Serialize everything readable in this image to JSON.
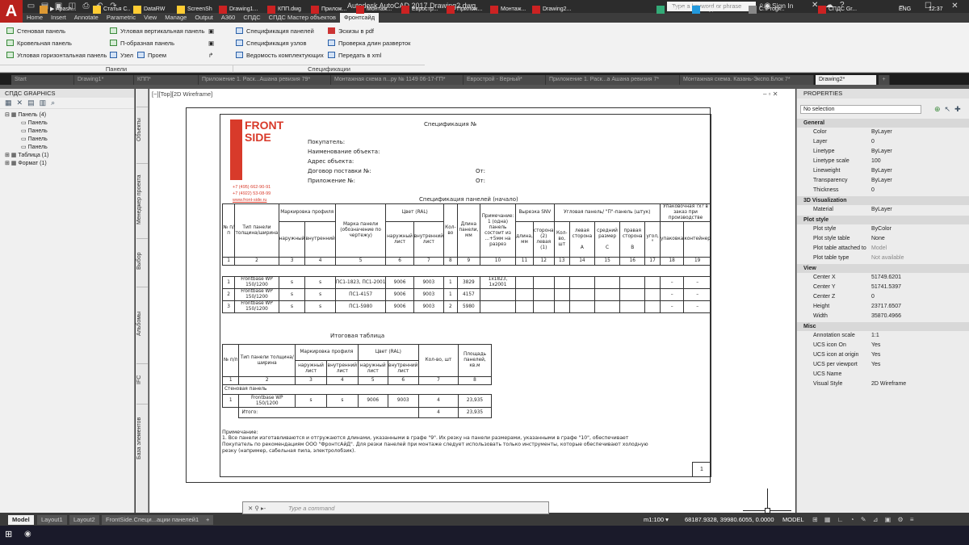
{
  "titlebar": {
    "app_letter": "A",
    "title": "Autodesk AutoCAD 2017   Drawing2.dwg",
    "search_placeholder": "Type a keyword or phrase",
    "sign_in": "Sign In"
  },
  "ribbon_tabs": [
    "Home",
    "Insert",
    "Annotate",
    "Parametric",
    "View",
    "Manage",
    "Output",
    "A360",
    "СПДС",
    "СПДС Мастер объектов",
    "Фронтсайд"
  ],
  "ribbon": {
    "col1": [
      "Стеновая панель",
      "Кровельная панель",
      "Угловая горизонтальная панель"
    ],
    "col2": [
      "Угловая вертикальная панель",
      "П-образная панель",
      "Узел",
      "Проем"
    ],
    "col3": [
      "Спецификация панелей",
      "Спецификация узлов",
      "Ведомость комплектующих"
    ],
    "col4": [
      "Эскизы в pdf",
      "Проверка длин разверток",
      "Передать в xml"
    ],
    "panel1": "Панели",
    "panel2": "Спецификации"
  },
  "file_tabs": [
    "Start",
    "Drawing1*",
    "КПП*",
    "Приложение 1. Раск...Ашана ревизия 79*",
    "Монтажная схема п...ру № 1149 06-17-ГП*",
    "Еврострой - Верный*",
    "Приложение 1. Раск...а Ашана ревизия 7*",
    "Монтажная схема. Казань-Экспо.Блок 7*",
    "Drawing2*"
  ],
  "left_palette": {
    "title": "СПДС GRAPHICS",
    "tree": [
      "Панель (4)",
      "Панель",
      "Панель",
      "Панель",
      "Панель",
      "Таблица (1)",
      "Формат (1)"
    ],
    "side_tabs": [
      "Объекты",
      "Менеджер проекта",
      "Выбор",
      "Альбомы",
      "IFC",
      "База элементов"
    ]
  },
  "viewport": {
    "label": "[−][Top][2D Wireframe]"
  },
  "sheet": {
    "logo": [
      "FRONT",
      "SIDE"
    ],
    "contacts": [
      "+7 (495) 662-90-91",
      "+7 (4922) 53-08-99",
      "www.front-side.ru"
    ],
    "title": "Спецификация №",
    "header_fields": [
      "Покупатель:",
      "Наименование объекта:",
      "Адрес объекта:",
      "Договор поставки №:",
      "Приложение №:"
    ],
    "from1": "От:",
    "from2": "От:",
    "table1_title": "Спецификация панелей (начало)",
    "t1_headers": [
      "№ п/п",
      "Тип панели толщина/ширина",
      "Маркировка профиля",
      "Марка панели (обозначение по чертежу)",
      "Цвет (RAL)",
      "Кол-во",
      "Длина панели, мм",
      "Примечание: 1 (одна) панель состоит из ...+5мм на разрез",
      "Вырезка SNV",
      "Угловая панель/ \"П\"-панель (штук)",
      "Упаковочная ?х? в заказ при производстве"
    ],
    "t1_sub": [
      "наружный",
      "внутренний",
      "наружный лист",
      "внутренний лист",
      "длина, мм",
      "сторона (2) левая (1)",
      "Кол-во, шт",
      "левая сторона",
      "средний размер",
      "правая сторона",
      "угол, °",
      "упаковка",
      "контейнер"
    ],
    "t1_letters": [
      "А",
      "С",
      "В"
    ],
    "t1_nums": [
      "1",
      "2",
      "3",
      "4",
      "5",
      "6",
      "7",
      "8",
      "9",
      "10",
      "11",
      "12",
      "13",
      "14",
      "15",
      "16",
      "17",
      "18",
      "19"
    ],
    "t1_rows": [
      [
        "1",
        "Frontbase WP 150/1200",
        "s",
        "s",
        "ПС1-1823, ПС1-2001",
        "9006",
        "9003",
        "1",
        "3829",
        "1x1823, 1x2001",
        "–",
        "–"
      ],
      [
        "2",
        "Frontbase WP 150/1200",
        "s",
        "s",
        "ПС1-4157",
        "9006",
        "9003",
        "1",
        "4157",
        "",
        "–",
        "–"
      ],
      [
        "3",
        "Frontbase WP 150/1200",
        "s",
        "s",
        "ПС1-5980",
        "9006",
        "9003",
        "2",
        "5980",
        "",
        "–",
        "–"
      ]
    ],
    "table2_title": "Итоговая таблица",
    "t2_headers": [
      "№ п/п",
      "Тип панели толщина/ширина",
      "Маркировка профиля",
      "Цвет (RAL)",
      "Кол-во, шт",
      "Площадь панелей, кв.м"
    ],
    "t2_sub": [
      "наружный лист",
      "внутренний лист",
      "наружный лист",
      "внутренний лист"
    ],
    "t2_nums": [
      "1",
      "2",
      "3",
      "4",
      "5",
      "6",
      "7",
      "8"
    ],
    "t2_section": "Стеновая панель",
    "t2_row": [
      "1",
      "Frontbase WP 150/1200",
      "s",
      "s",
      "9006",
      "9003",
      "4",
      "23,935"
    ],
    "t2_total_label": "Итого:",
    "t2_total_qty": "4",
    "t2_total_area": "23,935",
    "notes_title": "Примечание:",
    "notes": [
      "1. Все панели изготавливаются и отгружаются длинами, указанными в графе \"9\". Их резку на панели размерами, указанными в графе \"10\", обеспечивает",
      "Покупатель по рекомендациям ООО \"ФронтсАйД\". Для резки панелей при монтаже следует использовать только инструменты, которые обеспечивают холодную",
      "резку (например, сабельная пила, электролобзик)."
    ],
    "page": "1"
  },
  "properties": {
    "title": "PROPERTIES",
    "selection": "No selection",
    "sections": [
      {
        "name": "General",
        "rows": [
          [
            "Color",
            "ByLayer"
          ],
          [
            "Layer",
            "0"
          ],
          [
            "Linetype",
            "ByLayer"
          ],
          [
            "Linetype scale",
            "100"
          ],
          [
            "Lineweight",
            "ByLayer"
          ],
          [
            "Transparency",
            "ByLayer"
          ],
          [
            "Thickness",
            "0"
          ]
        ]
      },
      {
        "name": "3D Visualization",
        "rows": [
          [
            "Material",
            "ByLayer"
          ]
        ]
      },
      {
        "name": "Plot style",
        "rows": [
          [
            "Plot style",
            "ByColor"
          ],
          [
            "Plot style table",
            "None"
          ],
          [
            "Plot table attached to",
            "Model"
          ],
          [
            "Plot table type",
            "Not available"
          ]
        ]
      },
      {
        "name": "View",
        "rows": [
          [
            "Center X",
            "51749.6201"
          ],
          [
            "Center Y",
            "51741.5397"
          ],
          [
            "Center Z",
            "0"
          ],
          [
            "Height",
            "23717.6507"
          ],
          [
            "Width",
            "35870.4966"
          ]
        ]
      },
      {
        "name": "Misc",
        "rows": [
          [
            "Annotation scale",
            "1:1"
          ],
          [
            "UCS icon On",
            "Yes"
          ],
          [
            "UCS icon at origin",
            "Yes"
          ],
          [
            "UCS per viewport",
            "Yes"
          ],
          [
            "UCS Name",
            ""
          ],
          [
            "Visual Style",
            "2D Wireframe"
          ]
        ]
      }
    ]
  },
  "layout_tabs": [
    "Model",
    "Layout1",
    "Layout2",
    "FrontSide.Специ...ации панелей1"
  ],
  "command_placeholder": "Type a command",
  "status": {
    "scale": "m1:100 ▾",
    "coords": "68187.9328, 39980.6055, 0.0000",
    "model": "MODEL"
  },
  "taskbar": {
    "items": [
      "▶ Apash...",
      "Статья С...",
      "DataRW",
      "ScreenSh",
      "Drawing1...",
      "КПП.dwg",
      "Прилож...",
      "Монтаж...",
      "Евростр...",
      "Прилож...",
      "Монтаж...",
      "Drawing2...",
      "IDM x64",
      "Skype",
      "C:\\Progr...",
      "СПДС Gr..."
    ],
    "lang": "ENG",
    "time": "12:37"
  }
}
